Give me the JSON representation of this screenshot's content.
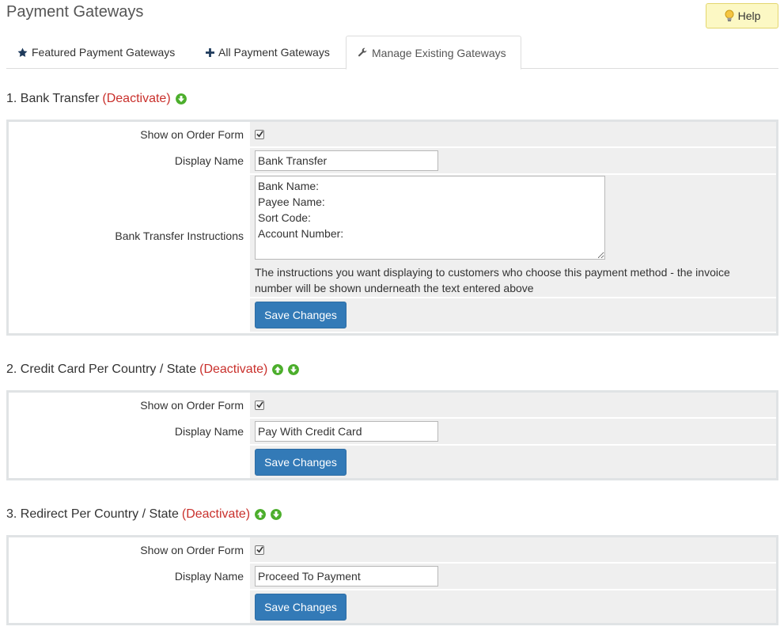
{
  "page": {
    "title": "Payment Gateways",
    "help_label": "Help"
  },
  "tabs": [
    {
      "label": "Featured Payment Gateways",
      "icon": "star-icon"
    },
    {
      "label": "All Payment Gateways",
      "icon": "plus-icon"
    },
    {
      "label": "Manage Existing Gateways",
      "icon": "wrench-icon",
      "active": true
    }
  ],
  "colors": {
    "deactivate": "#c9302c",
    "save_button": "#337ab7",
    "arrow_green": "#4cae2c"
  },
  "labels": {
    "show_on_order_form": "Show on Order Form",
    "display_name": "Display Name",
    "save_changes": "Save Changes",
    "deactivate": "(Deactivate)"
  },
  "gateways": [
    {
      "title": "1. Bank Transfer",
      "show_on_order_form": true,
      "display_name": "Bank Transfer",
      "instructions_label": "Bank Transfer Instructions",
      "instructions_value": "Bank Name:\nPayee Name:\nSort Code:\nAccount Number:",
      "instructions_help": "The instructions you want displaying to customers who choose this payment method - the invoice number will be shown underneath the text entered above",
      "arrows": [
        "down"
      ]
    },
    {
      "title": "2. Credit Card Per Country / State",
      "show_on_order_form": true,
      "display_name": "Pay With Credit Card",
      "arrows": [
        "up",
        "down"
      ]
    },
    {
      "title": "3. Redirect Per Country / State",
      "show_on_order_form": true,
      "display_name": "Proceed To Payment",
      "arrows": [
        "up",
        "down"
      ]
    }
  ]
}
